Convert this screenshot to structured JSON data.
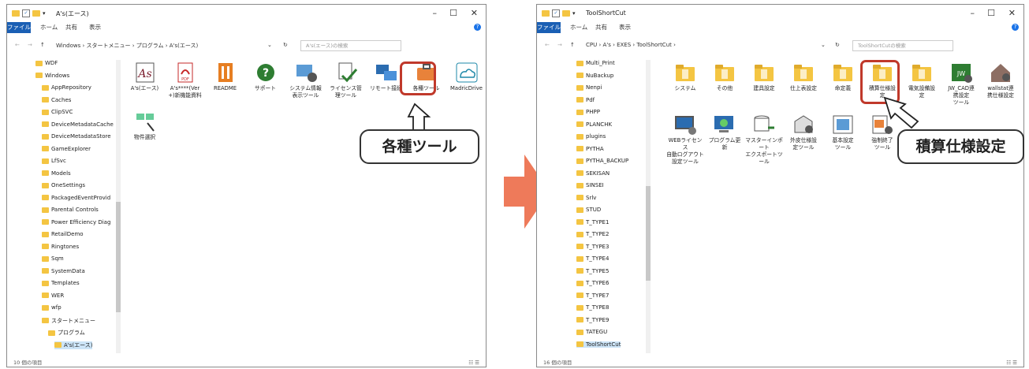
{
  "left_window": {
    "title": "A's(エース)",
    "ribbon_file": "ファイル",
    "ribbon_tabs": [
      "ホーム",
      "共有",
      "表示"
    ],
    "address_path": "Windows › スタートメニュー › プログラム › A's(エース)",
    "search_placeholder": "A's(エース)の検索",
    "sidebar_items": [
      "WDF",
      "Windows",
      "AppRepository",
      "Caches",
      "ClipSVC",
      "DeviceMetadataCache",
      "DeviceMetadataStore",
      "GameExplorer",
      "LfSvc",
      "Models",
      "OneSettings",
      "PackagedEventProvid",
      "Parental Controls",
      "Power Efficiency Diag",
      "RetailDemo",
      "Ringtones",
      "Sqm",
      "SystemData",
      "Templates",
      "WER",
      "wfp",
      "スタートメニュー",
      "プログラム",
      "A's(エース)"
    ],
    "files": [
      {
        "label": "A's(エース)",
        "icon": "as-logo-icon"
      },
      {
        "label": "A's****(Ver\n+)新機能資料",
        "icon": "pdf-icon"
      },
      {
        "label": "README",
        "icon": "readme-icon"
      },
      {
        "label": "サポート",
        "icon": "help-circle-icon"
      },
      {
        "label": "システム情報\n表示ツール",
        "icon": "system-info-icon"
      },
      {
        "label": "ライセンス管\n理ツール",
        "icon": "license-check-icon"
      },
      {
        "label": "リモート接続",
        "icon": "remote-connect-icon"
      },
      {
        "label": "各種ツール",
        "icon": "toolbox-icon"
      },
      {
        "label": "MadricDrive",
        "icon": "cloud-drive-icon"
      },
      {
        "label": "物件選択",
        "icon": "property-select-icon"
      }
    ],
    "status": "10 個の項目",
    "callout": "各種ツール"
  },
  "right_window": {
    "title": "ToolShortCut",
    "ribbon_file": "ファイル",
    "ribbon_tabs": [
      "ホーム",
      "共有",
      "表示"
    ],
    "address_path": "CPU › A's › EXES › ToolShortCut ›",
    "search_placeholder": "ToolShortCutの検索",
    "sidebar_items": [
      "Multi_Print",
      "NuBackup",
      "Nenpi",
      "Pdf",
      "PHPP",
      "PLANCHK",
      "plugins",
      "PYTHA",
      "PYTHA_BACKUP",
      "SEKISAN",
      "SINSEI",
      "Srlv",
      "STUD",
      "T_TYPE1",
      "T_TYPE2",
      "T_TYPE3",
      "T_TYPE4",
      "T_TYPE5",
      "T_TYPE6",
      "T_TYPE7",
      "T_TYPE8",
      "T_TYPE9",
      "TATEGU",
      "ToolShortCut"
    ],
    "files": [
      {
        "label": "システム",
        "icon": "folder-doc-icon"
      },
      {
        "label": "その他",
        "icon": "folder-pen-icon"
      },
      {
        "label": "建具設定",
        "icon": "folder-door-icon"
      },
      {
        "label": "仕上表設定",
        "icon": "folder-gear-icon"
      },
      {
        "label": "命定義",
        "icon": "folder-list-icon"
      },
      {
        "label": "積算仕様設\n定",
        "icon": "folder-calc-icon"
      },
      {
        "label": "電気設備設\n定",
        "icon": "folder-electric-icon"
      },
      {
        "label": "JW_CAD連\n携設定\nツール",
        "icon": "jwcad-gear-icon"
      },
      {
        "label": "wallstat連\n携仕様設定",
        "icon": "house-gear-icon"
      },
      {
        "label": "WEBライセンス\n自動ログアウト\n設定ツール",
        "icon": "monitor-gear-icon"
      },
      {
        "label": "プログラム更\n新",
        "icon": "update-icon"
      },
      {
        "label": "マスターインポート\nエクスポートツール",
        "icon": "db-import-icon"
      },
      {
        "label": "外皮仕様設\n定ツール",
        "icon": "envelope-gear-icon"
      },
      {
        "label": "基本設定\nツール",
        "icon": "settings-board-icon"
      },
      {
        "label": "強制終了\nツール",
        "icon": "force-quit-icon"
      }
    ],
    "status": "16 個の項目",
    "callout": "積算仕様設定"
  },
  "colors": {
    "accent_arrow": "#ee7a5a",
    "highlight_box": "#c0392b",
    "folder": "#f4c542",
    "ribbon_file": "#1a5fb4"
  }
}
